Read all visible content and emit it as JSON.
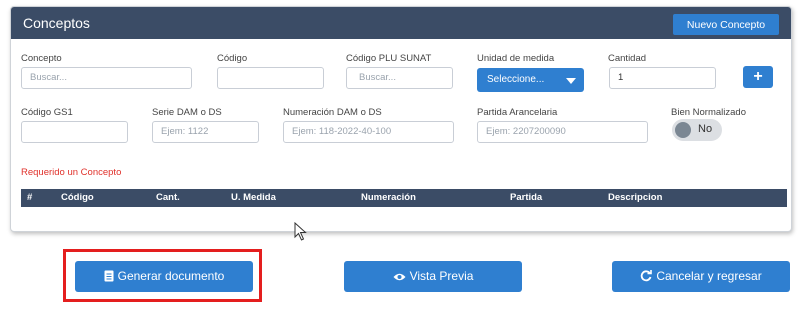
{
  "header": {
    "title": "Conceptos",
    "new_button": "Nuevo Concepto"
  },
  "row1": {
    "concepto": {
      "label": "Concepto",
      "placeholder": "Buscar..."
    },
    "codigo": {
      "label": "Código",
      "value": ""
    },
    "plu": {
      "label": "Código PLU SUNAT",
      "placeholder": "Buscar..."
    },
    "unidad": {
      "label": "Unidad de medida",
      "selected": "Seleccione..."
    },
    "cantidad": {
      "label": "Cantidad",
      "value": "1"
    },
    "add_button": "+"
  },
  "row2": {
    "gs1": {
      "label": "Código GS1",
      "value": ""
    },
    "serie": {
      "label": "Serie DAM o DS",
      "placeholder": "Ejem: 1122"
    },
    "numeracion": {
      "label": "Numeración DAM o DS",
      "placeholder": "Ejem: 118-2022-40-100"
    },
    "partida": {
      "label": "Partida Arancelaria",
      "placeholder": "Ejem: 2207200090"
    },
    "bien": {
      "label": "Bien Normalizado",
      "toggle": "No"
    }
  },
  "validation": "Requerido un Concepto",
  "table": {
    "headers": [
      "#",
      "Código",
      "Cant.",
      "U. Medida",
      "Numeración",
      "Partida",
      "Descripcion"
    ]
  },
  "actions": {
    "generate": "Generar documento",
    "preview": "Vista Previa",
    "cancel": "Cancelar y regresar"
  },
  "colors": {
    "header": "#3b4c66",
    "button": "#2f7fd0",
    "highlight": "#e41e1e",
    "error": "#e0312b"
  }
}
